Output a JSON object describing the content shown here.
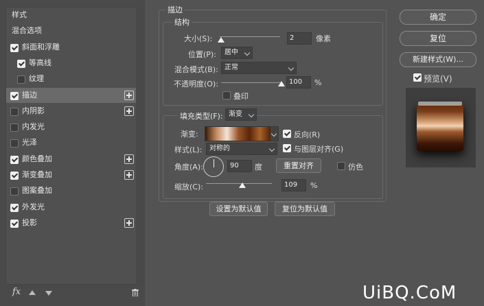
{
  "sidebar": {
    "items": [
      {
        "label": "样式",
        "checkbox": false,
        "checked": false,
        "plus": false,
        "selected": false,
        "indent": 0
      },
      {
        "label": "混合选项",
        "checkbox": false,
        "checked": false,
        "plus": false,
        "selected": false,
        "indent": 0
      },
      {
        "label": "斜面和浮雕",
        "checkbox": true,
        "checked": true,
        "plus": false,
        "selected": false,
        "indent": 0
      },
      {
        "label": "等高线",
        "checkbox": true,
        "checked": true,
        "plus": false,
        "selected": false,
        "indent": 1
      },
      {
        "label": "纹理",
        "checkbox": true,
        "checked": false,
        "plus": false,
        "selected": false,
        "indent": 1
      },
      {
        "label": "描边",
        "checkbox": true,
        "checked": true,
        "plus": true,
        "selected": true,
        "indent": 0
      },
      {
        "label": "内阴影",
        "checkbox": true,
        "checked": false,
        "plus": true,
        "selected": false,
        "indent": 0
      },
      {
        "label": "内发光",
        "checkbox": true,
        "checked": false,
        "plus": false,
        "selected": false,
        "indent": 0
      },
      {
        "label": "光泽",
        "checkbox": true,
        "checked": false,
        "plus": false,
        "selected": false,
        "indent": 0
      },
      {
        "label": "颜色叠加",
        "checkbox": true,
        "checked": true,
        "plus": true,
        "selected": false,
        "indent": 0
      },
      {
        "label": "渐变叠加",
        "checkbox": true,
        "checked": true,
        "plus": true,
        "selected": false,
        "indent": 0
      },
      {
        "label": "图案叠加",
        "checkbox": true,
        "checked": false,
        "plus": false,
        "selected": false,
        "indent": 0
      },
      {
        "label": "外发光",
        "checkbox": true,
        "checked": true,
        "plus": false,
        "selected": false,
        "indent": 0
      },
      {
        "label": "投影",
        "checkbox": true,
        "checked": true,
        "plus": true,
        "selected": false,
        "indent": 0
      }
    ],
    "fx_label": "fx"
  },
  "stroke": {
    "title": "描边",
    "structure_title": "结构",
    "size_label": "大小(S):",
    "size_value": "2",
    "size_unit": "像素",
    "size_slider_fraction": 0.0,
    "position_label": "位置(P):",
    "position_value": "居中",
    "blend_label": "混合模式(B):",
    "blend_value": "正常",
    "opacity_label": "不透明度(O):",
    "opacity_value": "100",
    "opacity_unit": "%",
    "opacity_slider_fraction": 1.0,
    "overprint_label": "叠印",
    "fill_type_label": "填充类型(F):",
    "fill_type_value": "渐变",
    "gradient_label": "渐变:",
    "reverse_label": "反向(R)",
    "style_label": "样式(L):",
    "style_value": "对称的",
    "align_label": "与图层对齐(G)",
    "angle_label": "角度(A):",
    "angle_value": "90",
    "angle_unit": "度",
    "reset_align_label": "重置对齐",
    "dither_label": "仿色",
    "scale_label": "缩放(C):",
    "scale_value": "109",
    "scale_unit": "%",
    "scale_slider_fraction": 0.55,
    "set_default_label": "设置为默认值",
    "reset_default_label": "复位为默认值"
  },
  "actions": {
    "ok_label": "确定",
    "reset_label": "复位",
    "new_style_label": "新建样式(W)...",
    "preview_label": "预览(V)"
  },
  "watermark": "UiBQ.CoM",
  "colors": {
    "gradient_stops": [
      "#3a1a08",
      "#c58a5e",
      "#f5e4d6",
      "#9a5429",
      "#5a2608",
      "#a8622c",
      "#4a2006"
    ]
  }
}
